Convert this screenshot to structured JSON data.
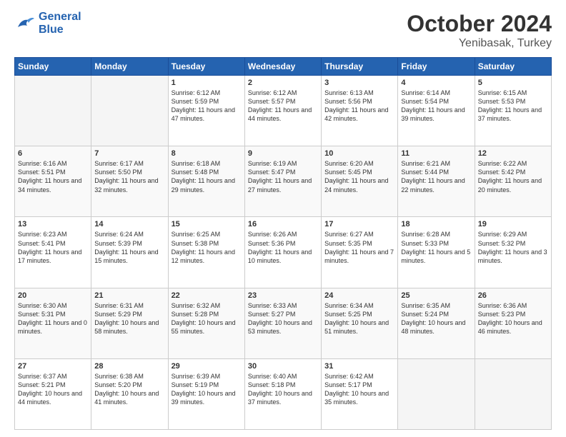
{
  "logo": {
    "line1": "General",
    "line2": "Blue"
  },
  "header": {
    "month": "October 2024",
    "location": "Yenibasak, Turkey"
  },
  "weekdays": [
    "Sunday",
    "Monday",
    "Tuesday",
    "Wednesday",
    "Thursday",
    "Friday",
    "Saturday"
  ],
  "weeks": [
    [
      {
        "day": "",
        "info": ""
      },
      {
        "day": "",
        "info": ""
      },
      {
        "day": "1",
        "info": "Sunrise: 6:12 AM\nSunset: 5:59 PM\nDaylight: 11 hours and 47 minutes."
      },
      {
        "day": "2",
        "info": "Sunrise: 6:12 AM\nSunset: 5:57 PM\nDaylight: 11 hours and 44 minutes."
      },
      {
        "day": "3",
        "info": "Sunrise: 6:13 AM\nSunset: 5:56 PM\nDaylight: 11 hours and 42 minutes."
      },
      {
        "day": "4",
        "info": "Sunrise: 6:14 AM\nSunset: 5:54 PM\nDaylight: 11 hours and 39 minutes."
      },
      {
        "day": "5",
        "info": "Sunrise: 6:15 AM\nSunset: 5:53 PM\nDaylight: 11 hours and 37 minutes."
      }
    ],
    [
      {
        "day": "6",
        "info": "Sunrise: 6:16 AM\nSunset: 5:51 PM\nDaylight: 11 hours and 34 minutes."
      },
      {
        "day": "7",
        "info": "Sunrise: 6:17 AM\nSunset: 5:50 PM\nDaylight: 11 hours and 32 minutes."
      },
      {
        "day": "8",
        "info": "Sunrise: 6:18 AM\nSunset: 5:48 PM\nDaylight: 11 hours and 29 minutes."
      },
      {
        "day": "9",
        "info": "Sunrise: 6:19 AM\nSunset: 5:47 PM\nDaylight: 11 hours and 27 minutes."
      },
      {
        "day": "10",
        "info": "Sunrise: 6:20 AM\nSunset: 5:45 PM\nDaylight: 11 hours and 24 minutes."
      },
      {
        "day": "11",
        "info": "Sunrise: 6:21 AM\nSunset: 5:44 PM\nDaylight: 11 hours and 22 minutes."
      },
      {
        "day": "12",
        "info": "Sunrise: 6:22 AM\nSunset: 5:42 PM\nDaylight: 11 hours and 20 minutes."
      }
    ],
    [
      {
        "day": "13",
        "info": "Sunrise: 6:23 AM\nSunset: 5:41 PM\nDaylight: 11 hours and 17 minutes."
      },
      {
        "day": "14",
        "info": "Sunrise: 6:24 AM\nSunset: 5:39 PM\nDaylight: 11 hours and 15 minutes."
      },
      {
        "day": "15",
        "info": "Sunrise: 6:25 AM\nSunset: 5:38 PM\nDaylight: 11 hours and 12 minutes."
      },
      {
        "day": "16",
        "info": "Sunrise: 6:26 AM\nSunset: 5:36 PM\nDaylight: 11 hours and 10 minutes."
      },
      {
        "day": "17",
        "info": "Sunrise: 6:27 AM\nSunset: 5:35 PM\nDaylight: 11 hours and 7 minutes."
      },
      {
        "day": "18",
        "info": "Sunrise: 6:28 AM\nSunset: 5:33 PM\nDaylight: 11 hours and 5 minutes."
      },
      {
        "day": "19",
        "info": "Sunrise: 6:29 AM\nSunset: 5:32 PM\nDaylight: 11 hours and 3 minutes."
      }
    ],
    [
      {
        "day": "20",
        "info": "Sunrise: 6:30 AM\nSunset: 5:31 PM\nDaylight: 11 hours and 0 minutes."
      },
      {
        "day": "21",
        "info": "Sunrise: 6:31 AM\nSunset: 5:29 PM\nDaylight: 10 hours and 58 minutes."
      },
      {
        "day": "22",
        "info": "Sunrise: 6:32 AM\nSunset: 5:28 PM\nDaylight: 10 hours and 55 minutes."
      },
      {
        "day": "23",
        "info": "Sunrise: 6:33 AM\nSunset: 5:27 PM\nDaylight: 10 hours and 53 minutes."
      },
      {
        "day": "24",
        "info": "Sunrise: 6:34 AM\nSunset: 5:25 PM\nDaylight: 10 hours and 51 minutes."
      },
      {
        "day": "25",
        "info": "Sunrise: 6:35 AM\nSunset: 5:24 PM\nDaylight: 10 hours and 48 minutes."
      },
      {
        "day": "26",
        "info": "Sunrise: 6:36 AM\nSunset: 5:23 PM\nDaylight: 10 hours and 46 minutes."
      }
    ],
    [
      {
        "day": "27",
        "info": "Sunrise: 6:37 AM\nSunset: 5:21 PM\nDaylight: 10 hours and 44 minutes."
      },
      {
        "day": "28",
        "info": "Sunrise: 6:38 AM\nSunset: 5:20 PM\nDaylight: 10 hours and 41 minutes."
      },
      {
        "day": "29",
        "info": "Sunrise: 6:39 AM\nSunset: 5:19 PM\nDaylight: 10 hours and 39 minutes."
      },
      {
        "day": "30",
        "info": "Sunrise: 6:40 AM\nSunset: 5:18 PM\nDaylight: 10 hours and 37 minutes."
      },
      {
        "day": "31",
        "info": "Sunrise: 6:42 AM\nSunset: 5:17 PM\nDaylight: 10 hours and 35 minutes."
      },
      {
        "day": "",
        "info": ""
      },
      {
        "day": "",
        "info": ""
      }
    ]
  ]
}
